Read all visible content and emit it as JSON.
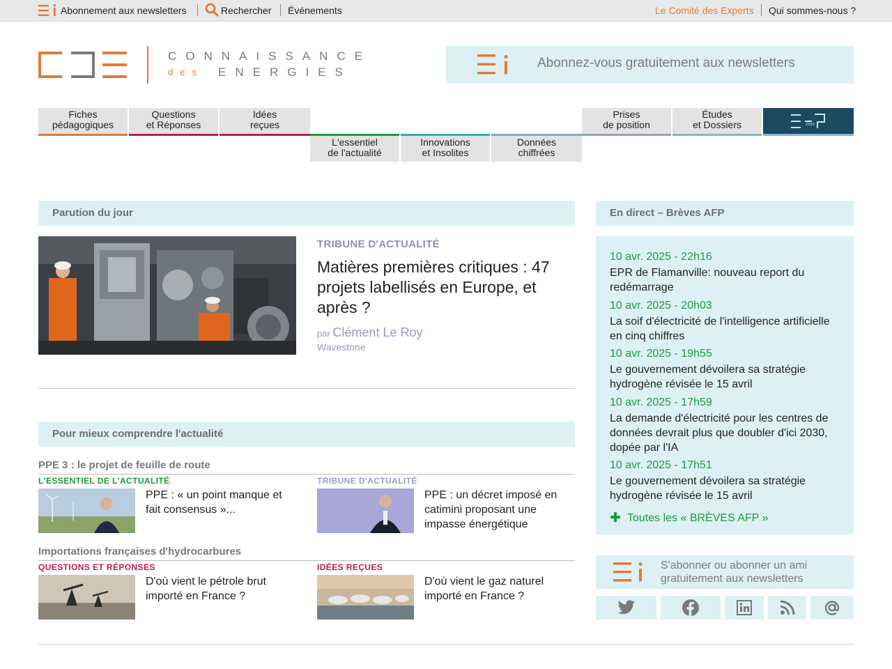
{
  "topbar": {
    "newsletter_label": "Abonnement aux newsletters",
    "search_label": "Rechercher",
    "events_label": "Événements",
    "experts_label": "Le Comité des Experts",
    "about_label": "Qui sommes-nous ?"
  },
  "logo": {
    "line1": "CONNAISSANCE",
    "line2_prefix": "des",
    "line2": "ENERGIES"
  },
  "banner": {
    "text": "Abonnez-vous gratuitement aux newsletters"
  },
  "nav": {
    "row1": [
      {
        "line1": "Fiches",
        "line2": "pédagogiques",
        "color": "#e07b39"
      },
      {
        "line1": "Questions",
        "line2": "et Réponses",
        "color": "#c2185b"
      },
      {
        "line1": "Idées",
        "line2": "reçues",
        "color": "#c2185b"
      },
      {
        "line1": "Prises",
        "line2": "de position",
        "color": "#9c9cc9"
      },
      {
        "line1": "Études",
        "line2": "et Dossiers",
        "color": "#8fb0cf"
      }
    ],
    "row2": [
      {
        "line1": "L'essentiel",
        "line2": "de l'actualité",
        "color": "#1c9a3e"
      },
      {
        "line1": "Innovations",
        "line2": "et Insolites",
        "color": "#2bb3a5"
      },
      {
        "line1": "Données",
        "line2": "chiffrées",
        "color": "#7fa7c8"
      }
    ],
    "efp_label": "2050"
  },
  "parution": {
    "header": "Parution du jour",
    "category": "TRIBUNE D'ACTUALITÉ",
    "title": "Matières premières critiques : 47 projets labellisés en Europe, et après ?",
    "by": "par",
    "author": "Clément Le Roy",
    "org": "Wavestone"
  },
  "understand": {
    "header": "Pour mieux comprendre l'actualité",
    "topics": [
      {
        "title": "PPE 3 : le projet de feuille de route",
        "cards": [
          {
            "category": "L'ESSENTIEL DE L'ACTUALITÉ",
            "color": "#1c9a3e",
            "text": "PPE : « un point manque et fait consensus »..."
          },
          {
            "category": "TRIBUNE D'ACTUALITÉ",
            "color": "#9c9cc9",
            "text": "PPE : un décret imposé en catimini proposant une impasse énergétique"
          }
        ]
      },
      {
        "title": "Importations françaises d'hydrocarbures",
        "cards": [
          {
            "category": "QUESTIONS ET RÉPONSES",
            "color": "#c2185b",
            "text": "D'où vient le pétrole brut importé en France ?"
          },
          {
            "category": "IDÉES REÇUES",
            "color": "#c2185b",
            "text": "D'où vient le gaz naturel importé en France ?"
          }
        ]
      }
    ]
  },
  "afp": {
    "header": "En direct – Brèves AFP",
    "items": [
      {
        "date": "10 avr. 2025 - 22h16",
        "text": "EPR de Flamanville: nouveau report du redémarrage"
      },
      {
        "date": "10 avr. 2025 - 20h03",
        "text": "La soif d'électricité de l'intelligence artificielle en cinq chiffres"
      },
      {
        "date": "10 avr. 2025 - 19h55",
        "text": "Le gouvernement dévoilera sa stratégie hydrogène révisée le 15 avril"
      },
      {
        "date": "10 avr. 2025 - 17h59",
        "text": "La demande d'électricité pour les centres de données devrait plus que doubler d'ici 2030, dopée par l'IA"
      },
      {
        "date": "10 avr. 2025 - 17h51",
        "text": "Le gouvernement dévoilera sa stratégie hydrogène révisée le 15 avril"
      }
    ],
    "all_label": "Toutes les « BRÈVES AFP »"
  },
  "subscribe": {
    "line1": "S'abonner ou abonner un ami",
    "line2": "gratuitement aux newsletters"
  },
  "social": [
    "twitter-icon",
    "facebook-icon",
    "linkedin-icon",
    "rss-icon",
    "email-icon"
  ],
  "colors": {
    "brand_orange": "#e07b39",
    "light_blue_bg": "#ddf1f5",
    "afp_green": "#1c9a3e",
    "tribune_purple": "#9c9cc9",
    "dark_teal": "#1c4a63"
  }
}
